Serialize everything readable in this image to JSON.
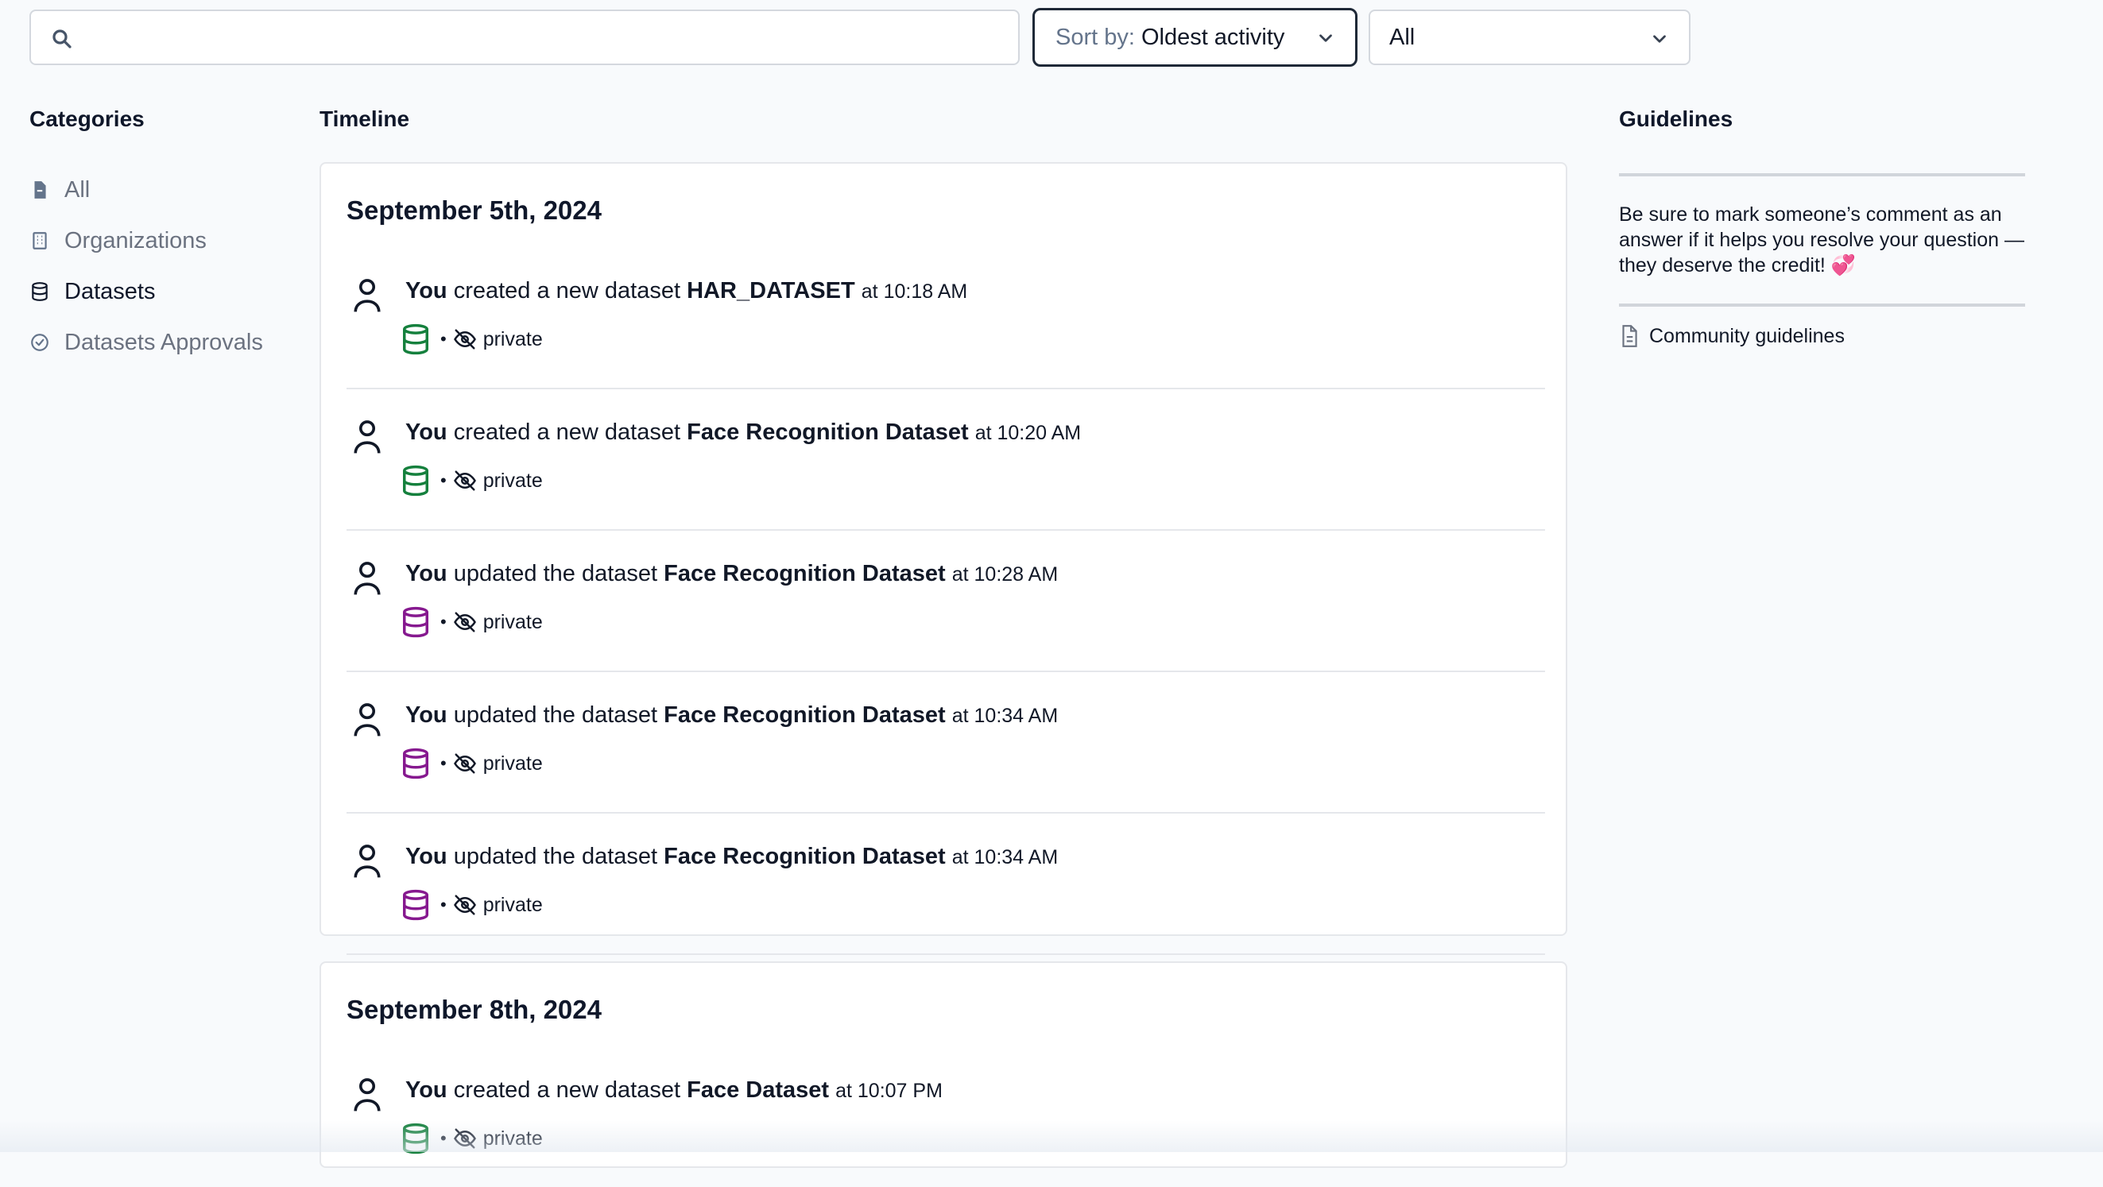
{
  "search": {
    "placeholder": ""
  },
  "sort": {
    "prefix": "Sort by:",
    "value": "Oldest activity"
  },
  "filter": {
    "value": "All"
  },
  "categories": {
    "heading": "Categories",
    "items": [
      {
        "label": "All",
        "icon": "file-icon"
      },
      {
        "label": "Organizations",
        "icon": "building-icon"
      },
      {
        "label": "Datasets",
        "icon": "database-icon"
      },
      {
        "label": "Datasets Approvals",
        "icon": "check-circle-icon"
      }
    ]
  },
  "timeline": {
    "heading": "Timeline",
    "groups": [
      {
        "date": "September 5th, 2024",
        "entries": [
          {
            "actor": "You",
            "action": "created a new dataset",
            "target": "HAR_DATASET",
            "time": "at 10:18 AM",
            "visibility": "private",
            "db_color": "#15803d"
          },
          {
            "actor": "You",
            "action": "created a new dataset",
            "target": "Face Recognition Dataset",
            "time": "at 10:20 AM",
            "visibility": "private",
            "db_color": "#15803d"
          },
          {
            "actor": "You",
            "action": "updated the dataset",
            "target": "Face Recognition Dataset",
            "time": "at 10:28 AM",
            "visibility": "private",
            "db_color": "#86198f"
          },
          {
            "actor": "You",
            "action": "updated the dataset",
            "target": "Face Recognition Dataset",
            "time": "at 10:34 AM",
            "visibility": "private",
            "db_color": "#86198f"
          },
          {
            "actor": "You",
            "action": "updated the dataset",
            "target": "Face Recognition Dataset",
            "time": "at 10:34 AM",
            "visibility": "private",
            "db_color": "#86198f"
          }
        ]
      },
      {
        "date": "September 8th, 2024",
        "entries": [
          {
            "actor": "You",
            "action": "created a new dataset",
            "target": "Face Dataset",
            "time": "at 10:07 PM",
            "visibility": "private",
            "db_color": "#15803d"
          }
        ]
      }
    ]
  },
  "guidelines": {
    "heading": "Guidelines",
    "text": "Be sure to mark someone’s comment as an answer if it helps you resolve your question — they deserve the credit! 💞",
    "link_label": "Community guidelines"
  }
}
